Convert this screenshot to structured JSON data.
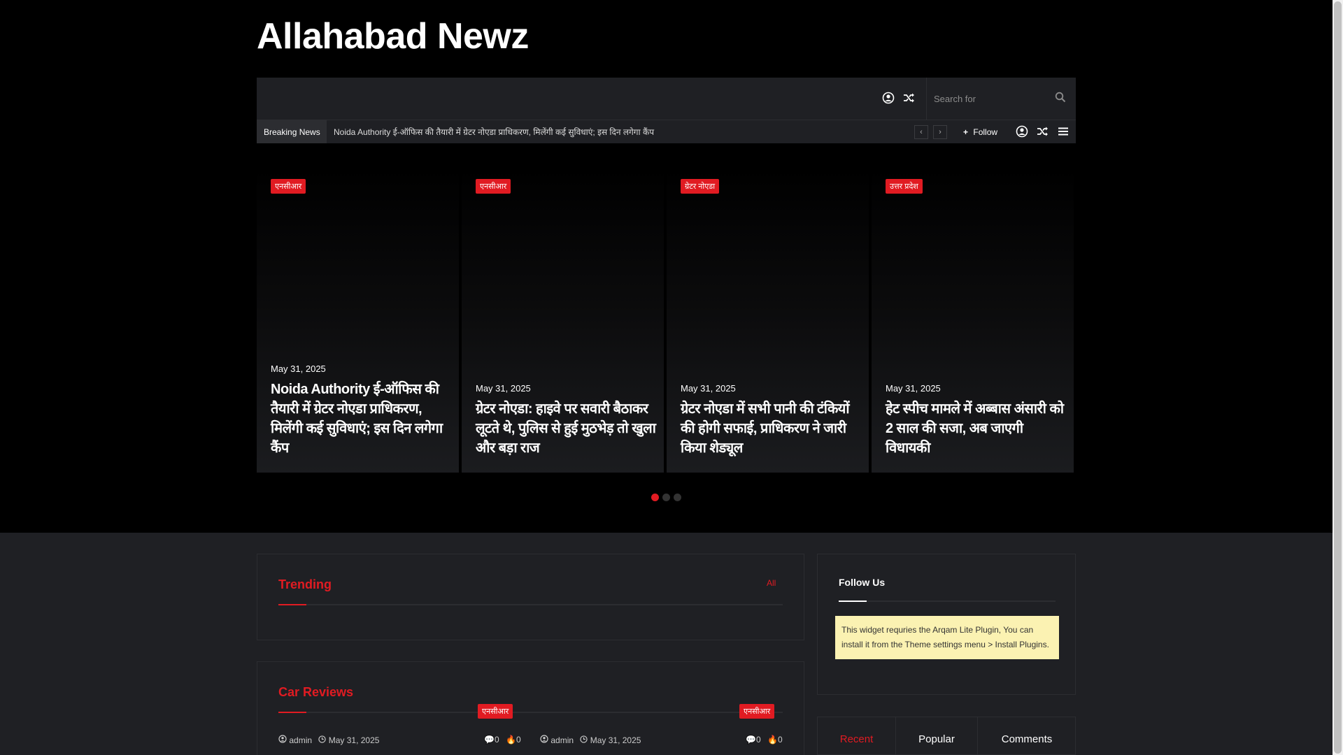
{
  "site": {
    "title": "Allahabad Newz"
  },
  "nav": {
    "search_placeholder": "Search for",
    "icons": [
      "user-icon",
      "random-icon",
      "search-icon"
    ]
  },
  "breaking": {
    "label": "Breaking News",
    "headline": "Noida Authority ई-ऑफिस की तैयारी में ग्रेटर नोएडा प्राधिकरण, मिलेंगी कई सुविधाएं; इस दिन लगेगा कैंप",
    "follow_label": "Follow"
  },
  "slides": [
    {
      "tag": "एनसीआर",
      "date": "May 31, 2025",
      "title": "Noida Authority ई-ऑफिस की तैयारी में ग्रेटर नोएडा प्राधिकरण, मिलेंगी कई सुविधाएं; इस दिन लगेगा कैंप"
    },
    {
      "tag": "एनसीआर",
      "date": "May 31, 2025",
      "title": "ग्रेटर नोएडा: हाइवे पर सवारी बैठाकर लूटते थे, पुलिस से हुई मुठभेड़ तो खुला और बड़ा राज"
    },
    {
      "tag": "ग्रेटर नोएडा",
      "date": "May 31, 2025",
      "title": "ग्रेटर नोएडा में सभी पानी की टंकियों की होगी सफाई, प्राधिकरण ने जारी किया शेड्यूल"
    },
    {
      "tag": "उत्तर प्रदेश",
      "date": "May 31, 2025",
      "title": "हेट स्पीच मामले में अब्बास अंसारी को 2 साल की सजा, अब जाएगी विधायकी"
    }
  ],
  "slider_dots": {
    "count": 3,
    "active": 1
  },
  "trending": {
    "title": "Trending",
    "link": "All"
  },
  "car_reviews": {
    "title": "Car Reviews",
    "posts": [
      {
        "tag": "एनसीआर",
        "author": "admin",
        "date": "May 31, 2025",
        "comments": "0",
        "likes": "0"
      },
      {
        "tag": "एनसीआर",
        "author": "admin",
        "date": "May 31, 2025",
        "comments": "0",
        "likes": "0"
      }
    ]
  },
  "follow_us": {
    "title": "Follow Us",
    "notice": "This widget requries the Arqam Lite Plugin, You can install it from the Theme settings menu > Install Plugins."
  },
  "tabs": [
    "Recent",
    "Popular",
    "Comments"
  ],
  "colors": {
    "accent": "#e11b22",
    "dark": "#1f2024",
    "black": "#000000",
    "notice": "#fbf2b2"
  }
}
